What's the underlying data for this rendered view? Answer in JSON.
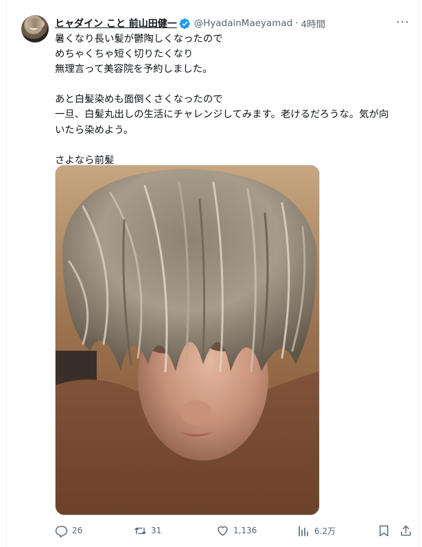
{
  "author": {
    "display_name": "ヒャダイン こと 前山田健一",
    "handle": "@HyadainMaeyamad",
    "separator": "·",
    "time": "4時間",
    "verified": true
  },
  "tweet": {
    "text": "暑くなり長い髪が鬱陶しくなったので\nめちゃくちゃ短く切りたくなり\n無理言って美容院を予約しました。\n\nあと白髪染めも面倒くさくなったので\n一旦、白髪丸出しの生活にチャレンジしてみます。老けるだろうな。気が向\nいたら染めよう。\n\nさよなら前髪"
  },
  "actions": {
    "reply_count": "26",
    "retweet_count": "31",
    "like_count": "1,136",
    "view_count": "6.2万"
  },
  "icons": {
    "more": "more-icon",
    "verified": "verified-badge-icon",
    "reply": "reply-icon",
    "retweet": "retweet-icon",
    "like": "heart-icon",
    "views": "views-icon",
    "bookmark": "bookmark-icon",
    "share": "share-icon"
  },
  "colors": {
    "verified": "#1d9bf0",
    "secondary_text": "#536471",
    "primary_text": "#0f1419"
  }
}
